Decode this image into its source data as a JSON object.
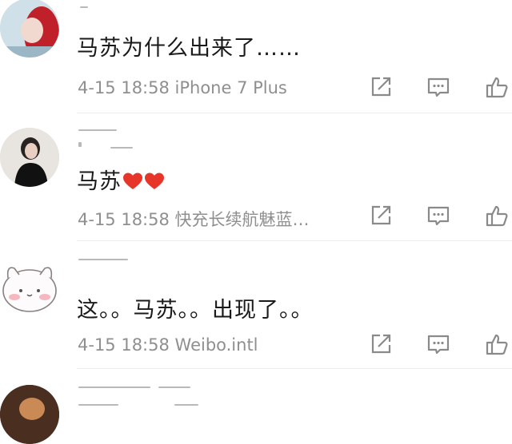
{
  "comments": [
    {
      "text": "马苏为什么出来了……",
      "meta": "4-15 18:58 iPhone 7 Plus",
      "avatar": "avatar-red-hair"
    },
    {
      "text": "马苏",
      "emoji": [
        "heart-icon",
        "heart-icon"
      ],
      "meta": "4-15 18:58 快充长续航魅蓝…",
      "avatar": "avatar-girl-photo"
    },
    {
      "text": "这。。马苏。。出现了。。",
      "meta": "4-15 18:58 Weibo.intl",
      "avatar": "avatar-cartoon-bunny"
    }
  ],
  "actions": [
    "share-icon",
    "comment-icon",
    "like-icon"
  ],
  "colors": {
    "text": "#1a1a1a",
    "meta": "#8f8f8f",
    "icon": "#8a8a8a",
    "heart": "#e8352a",
    "divider": "#ececec"
  }
}
